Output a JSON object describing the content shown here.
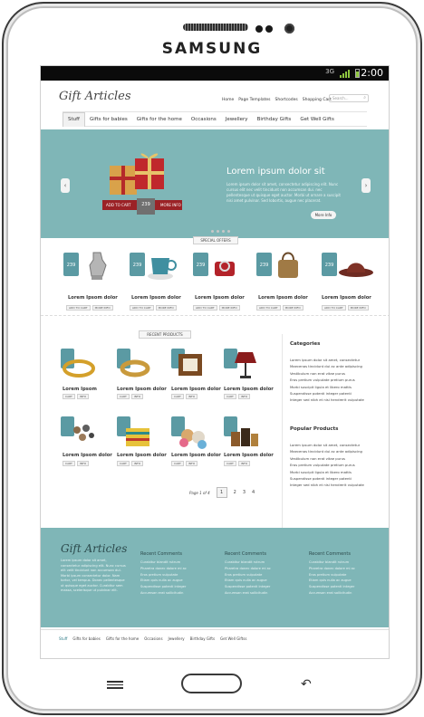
{
  "device": {
    "brand": "SAMSUNG",
    "status": {
      "time": "2:00",
      "network": "3G"
    }
  },
  "site": {
    "logo": "Gift Articles",
    "top_nav": [
      "Home",
      "Page Templates",
      "Shortcodes",
      "Shopping Cart"
    ],
    "search_placeholder": "Search...",
    "main_nav": [
      "Stuff",
      "Gifts for babies",
      "Gifts for the home",
      "Occasions",
      "Jewellery",
      "Birthday Gifts",
      "Get Well Gifts"
    ]
  },
  "hero": {
    "title": "Lorem ipsum dolor sit",
    "text": "Lorem ipsum dolor sit amet, consectetur adipiscing elit. Nunc cursus elit nec velit tincidunt non accumsan dui. nec pellentesque ut quisque eget auctor. Morbi ut ornare a suscipit nisi amet pulvinar. Sed lobortis, augue nec placerat.",
    "button": "More Info",
    "price": "239",
    "add_to_cart": "ADD TO CART",
    "more_info": "MORE INFO"
  },
  "special_offers": {
    "label": "SPECIAL OFFERS",
    "items": [
      {
        "name": "Lorem Ipsom dolor",
        "price": "239"
      },
      {
        "name": "Lorem Ipsom dolor",
        "price": "239"
      },
      {
        "name": "Lorem Ipsom dolor",
        "price": "239"
      },
      {
        "name": "Lorem Ipsom dolor",
        "price": "239"
      },
      {
        "name": "Lorem Ipsom dolor",
        "price": "239"
      }
    ],
    "btn_cart": "ADD TO CART",
    "btn_info": "MORE INFO"
  },
  "recent_products": {
    "label": "RECENT PRODUCTS",
    "row1": [
      "Lorem Ipsom",
      "Lorem Ipsom dolor",
      "Lorem Ipsom dolor",
      "Lorem Ipsom dolor"
    ],
    "row2": [
      "Lorem Ipsom dolor",
      "Lorem Ipsom dolor",
      "Lorem Ipsom dolor",
      "Lorem Ipsom dolor"
    ],
    "btn_cart": "CART",
    "btn_info": "INFO"
  },
  "pagination": {
    "label": "Page 1 of 4",
    "pages": [
      "1",
      "2",
      "3",
      "4"
    ]
  },
  "sidebar": {
    "categories_title": "Categories",
    "categories": [
      "Lorem ipsum dolor sit amet, consectetur",
      "Maecenas tincidunt dui ac ante adipiscing",
      "Vestibulum non erat vitae purus",
      "Eros pretium vulputate pretium purus",
      "Morbi suscipit ligula et libero mattis",
      "Suspendisse potenti integer potenti",
      "Integer sed nibh et nisi hendrerit vulputate"
    ],
    "popular_title": "Popular Products",
    "popular": [
      "Lorem ipsum dolor sit amet, consectetur",
      "Maecenas tincidunt dui ac ante adipiscing",
      "Vestibulum non erat vitae purus",
      "Eros pretium vulputate pretium purus",
      "Morbi suscipit ligula et libero mattis",
      "Suspendisse potenti integer potenti",
      "Integer sed nibh et nisi hendrerit vulputate"
    ]
  },
  "footer": {
    "logo": "Gift Articles",
    "text": "Lorem ipsum dolor sit amet, consectetur adipiscing elit. Nunc cursus elit velit tincidunt non accumsan dui. Morbi ipsum consectetur dolor. Nam tortor, vel tempus. Donec pellentesque ut quisque eget auctor. Curabitur sem massa, scelerisque ut pulvinar elit.",
    "columns": [
      {
        "title": "Recent Comments",
        "items": [
          "Curabitur blandit rutrum",
          "Pharetra donec dolore mi ac",
          "Eros pretium vulputate",
          "Etiam quis nulla ac augue",
          "Suspendisse potenti integer",
          "Accumsan erat sollicitudin"
        ]
      },
      {
        "title": "Recent Comments",
        "items": [
          "Curabitur blandit rutrum",
          "Pharetra donec dolore mi ac",
          "Eros pretium vulputate",
          "Etiam quis nulla ac augue",
          "Suspendisse potenti integer",
          "Accumsan erat sollicitudin"
        ]
      },
      {
        "title": "Recent Comments",
        "items": [
          "Curabitur blandit rutrum",
          "Pharetra donec dolore mi ac",
          "Eros pretium vulputate",
          "Etiam quis nulla ac augue",
          "Suspendisse potenti integer",
          "Accumsan erat sollicitudin"
        ]
      }
    ],
    "nav": [
      "Stuff",
      "Gifts for babies",
      "Gifts for the home",
      "Occasions",
      "Jewellery",
      "Birthday Gifts",
      "Get Well Giftss"
    ]
  },
  "colors": {
    "teal": "#7fb6b7",
    "price_tag": "#5b9aa3",
    "ribbon": "#9b2226"
  }
}
